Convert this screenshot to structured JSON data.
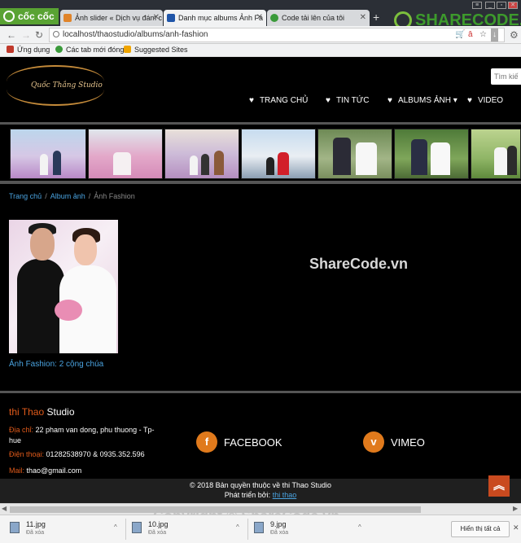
{
  "browser": {
    "brand": "cốc cốc",
    "tabs": [
      {
        "label": "Ảnh slider « Dịch vụ đám c",
        "color": "#e0842a"
      },
      {
        "label": "Danh mục albums Ảnh Fa",
        "color": "#1f55a8"
      },
      {
        "label": "Code tải lên của tôi",
        "color": "#3a9a3a"
      }
    ],
    "url": "localhost/thaostudio/albums/anh-fashion",
    "bookmarks": [
      "Ứng dụng",
      "Các tab mới đóng",
      "Suggested Sites"
    ],
    "watermark_logo": "SHARECODE.vn"
  },
  "site": {
    "brand_name": "Quốc Thắng Studio",
    "search_placeholder": "Tìm kiế",
    "menu": [
      {
        "label": "TRANG CHỦ"
      },
      {
        "label": "TIN TỨC"
      },
      {
        "label": "ALBUMS ẢNH ▾"
      },
      {
        "label": "VIDEO"
      }
    ]
  },
  "breadcrumb": {
    "home": "Trang chủ",
    "albums": "Album ảnh",
    "current": "Ảnh Fashion"
  },
  "album": {
    "caption": "Ảnh Fashion: 2 cộng chúa"
  },
  "watermark_center": "ShareCode.vn",
  "footer": {
    "name_highlight": "thi Thao",
    "name_rest": " Studio",
    "address_label": "Địa chỉ:",
    "address": "22 pham van dong, phu thuong - Tp-hue",
    "phone_label": "Điện thoại:",
    "phone": "01282538970 & 0935.352.596",
    "mail_label": "Mail:",
    "mail": "thao@gmail.com",
    "facebook": "FACEBOOK",
    "facebook_icon": "f",
    "vimeo": "VIMEO",
    "vimeo_icon": "v",
    "copyright": "© 2018 Bản quyền thuộc về thi Thao Studio",
    "developed_label": "Phát triển bởi:",
    "developed_by": "thi thao"
  },
  "downloads": {
    "items": [
      {
        "name": "11.jpg",
        "status": "Đã xóa"
      },
      {
        "name": "10.jpg",
        "status": "Đã xóa"
      },
      {
        "name": "9.jpg",
        "status": "Đã xóa"
      }
    ],
    "show_all": "Hiển thị tất cả"
  },
  "watermark_bottom": "Copyright © ShareCode.vn"
}
